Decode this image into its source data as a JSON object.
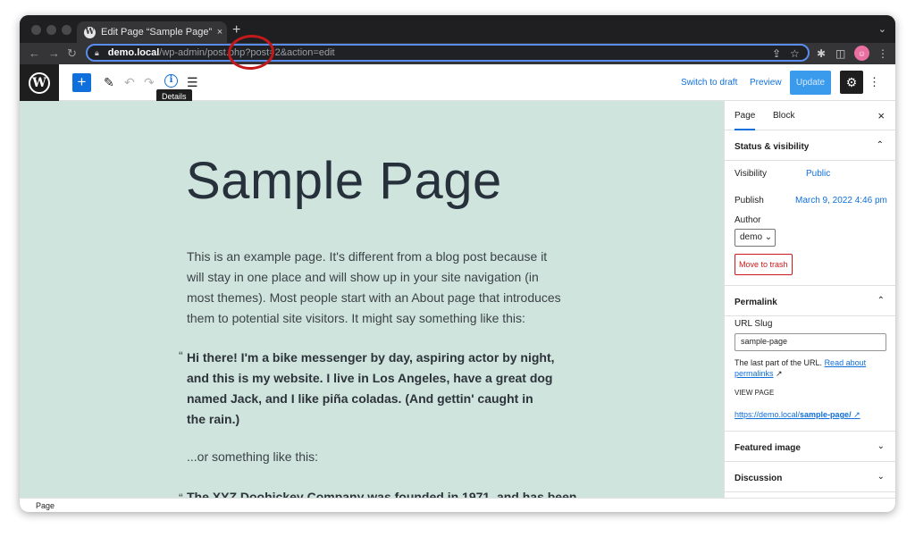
{
  "browser": {
    "tab_title": "Edit Page “Sample Page” ‹ Dem",
    "tab_close": "×",
    "new_tab": "+",
    "url_host": "demo.local",
    "url_path": "/wp-admin/post.php?post=2&action=edit"
  },
  "editor": {
    "add_block": "+",
    "tooltip": "Details",
    "switch_to_draft": "Switch to draft",
    "preview": "Preview",
    "update": "Update"
  },
  "content": {
    "title": "Sample Page",
    "paragraph1": "This is an example page. It's different from a blog post because it will stay in one place and will show up in your site navigation (in most themes). Most people start with an About page that introduces them to potential site visitors. It might say something like this:",
    "quote1": "Hi there! I'm a bike messenger by day, aspiring actor by night, and this is my website. I live in Los Angeles, have a great dog named Jack, and I like piña coladas. (And gettin' caught in the rain.)",
    "paragraph2": "...or something like this:",
    "quote2": "The XYZ Doohickey Company was founded in 1971, and has been",
    "quote_mark": "“"
  },
  "sidebar": {
    "tab_page": "Page",
    "tab_block": "Block",
    "close": "×",
    "status_visibility": "Status & visibility",
    "visibility_label": "Visibility",
    "visibility_value": "Public",
    "publish_label": "Publish",
    "publish_value": "March 9, 2022 4:46 pm",
    "author_label": "Author",
    "author_value": "demo",
    "move_to_trash": "Move to trash",
    "permalink": "Permalink",
    "url_slug_label": "URL Slug",
    "url_slug_value": "sample-page",
    "help_text": "The last part of the URL.",
    "help_link": "Read about permalinks",
    "view_page": "VIEW PAGE",
    "permalink_prefix": "https://demo.local/",
    "permalink_slug": "sample-page/",
    "featured_image": "Featured image",
    "discussion": "Discussion"
  },
  "statusbar": {
    "breadcrumb": "Page"
  },
  "colors": {
    "canvas_bg": "#cfe4dc",
    "accent": "#0f6fdb",
    "annotation": "#c4191b"
  }
}
